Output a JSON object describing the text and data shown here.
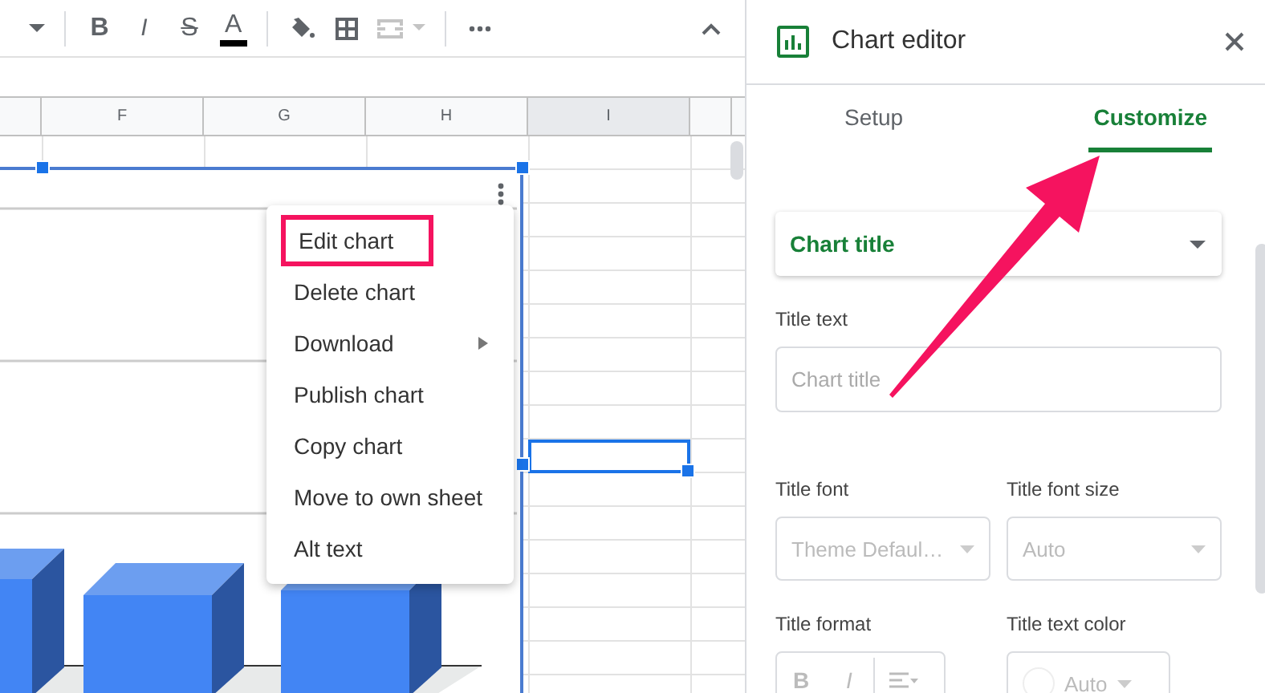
{
  "toolbar": [
    {
      "kind": "caret",
      "disabled": false
    },
    {
      "kind": "divider"
    },
    {
      "kind": "bold",
      "label": "B",
      "disabled": false
    },
    {
      "kind": "italic",
      "label": "I",
      "disabled": false
    },
    {
      "kind": "strike",
      "label": "S",
      "disabled": false
    },
    {
      "kind": "textcolor",
      "label": "A",
      "disabled": false
    },
    {
      "kind": "divider"
    },
    {
      "kind": "fill",
      "disabled": false
    },
    {
      "kind": "borders",
      "disabled": false
    },
    {
      "kind": "merge",
      "disabled": true
    },
    {
      "kind": "divider"
    },
    {
      "kind": "more",
      "disabled": false
    }
  ],
  "columns": [
    {
      "label": "F",
      "selected": false
    },
    {
      "label": "G",
      "selected": false
    },
    {
      "label": "H",
      "selected": false
    },
    {
      "label": "I",
      "selected": true
    }
  ],
  "chart_menu": [
    {
      "label": "Edit chart",
      "outlined": true,
      "submenu": false
    },
    {
      "label": "Delete chart",
      "outlined": false,
      "submenu": false
    },
    {
      "label": "Download",
      "outlined": false,
      "submenu": true
    },
    {
      "label": "Publish chart",
      "outlined": false,
      "submenu": false
    },
    {
      "label": "Copy chart",
      "outlined": false,
      "submenu": false
    },
    {
      "label": "Move to own sheet",
      "outlined": false,
      "submenu": false
    },
    {
      "label": "Alt text",
      "outlined": false,
      "submenu": false
    }
  ],
  "editor": {
    "title": "Chart editor",
    "tabs": [
      {
        "label": "Setup",
        "selected": false
      },
      {
        "label": "Customize",
        "selected": true
      }
    ],
    "section": {
      "label": "Chart title"
    },
    "title_text": {
      "label": "Title text",
      "placeholder": "Chart title"
    },
    "font_fields": [
      {
        "label": "Title font",
        "value": "Theme Defaul…",
        "disabled": true
      },
      {
        "label": "Title font size",
        "value": "Auto",
        "disabled": true
      }
    ],
    "format": {
      "label": "Title format",
      "buttons": [
        {
          "kind": "bold",
          "label": "B"
        },
        {
          "kind": "italic",
          "label": "I"
        },
        {
          "kind": "align"
        }
      ]
    },
    "color": {
      "label": "Title text color",
      "value": "Auto",
      "disabled": true
    }
  }
}
